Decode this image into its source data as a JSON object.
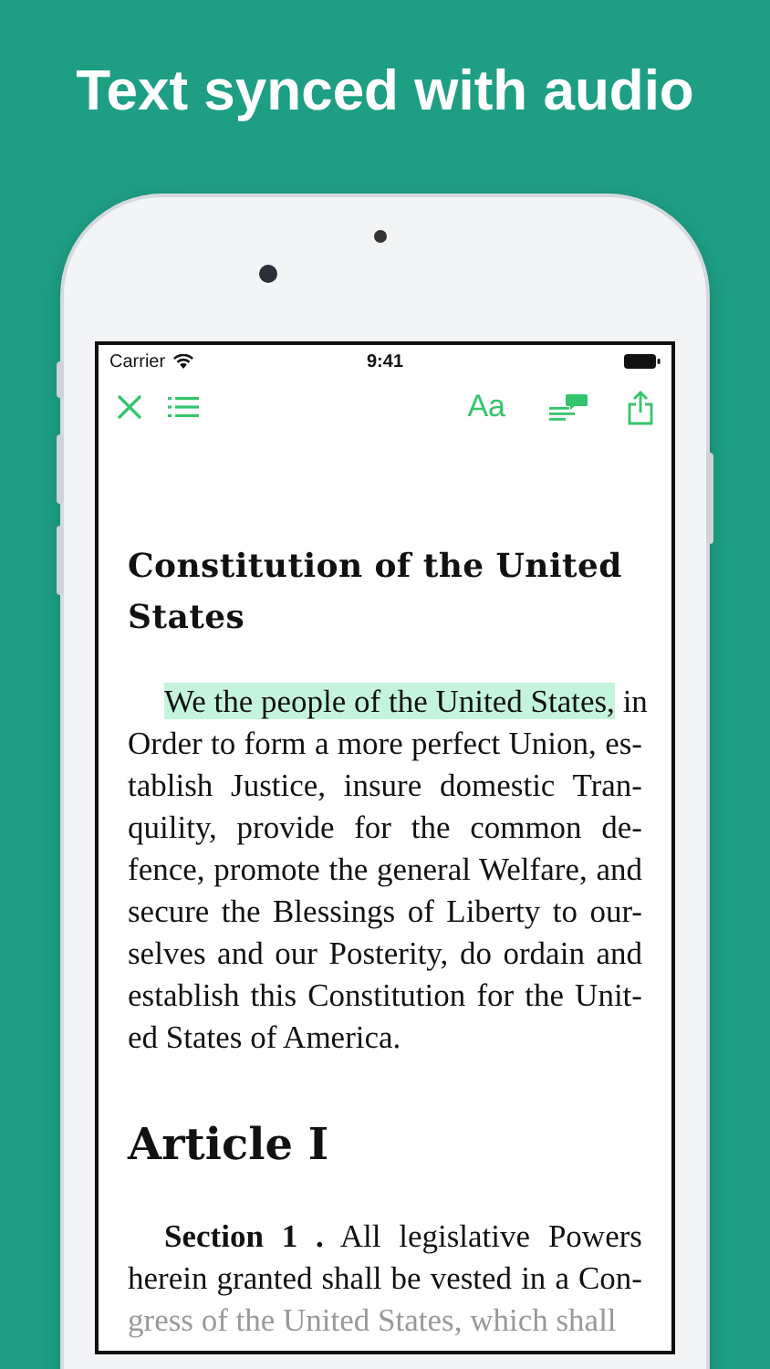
{
  "headline": "Text synced with audio",
  "status_bar": {
    "carrier": "Carrier",
    "time": "9:41"
  },
  "toolbar": {
    "font_button": "Aa"
  },
  "document": [
    {
      "kind": "title",
      "text": "Constitution of the United States"
    },
    {
      "kind": "paragraph",
      "lines": [
        [
          {
            "text": "We the people of the United States,",
            "highlighted": true
          },
          {
            "text": " in",
            "highlighted": false
          }
        ],
        [
          {
            "text": "Order to form a more perfect Union, es-",
            "highlighted": false
          }
        ],
        [
          {
            "text": "tablish Justice, insure domestic Tran-",
            "highlighted": false
          }
        ],
        [
          {
            "text": "quility, provide for the common de-",
            "highlighted": false
          }
        ],
        [
          {
            "text": "fence, promote the general Welfare, and",
            "highlighted": false
          }
        ],
        [
          {
            "text": "secure the Blessings of Liberty to our-",
            "highlighted": false
          }
        ],
        [
          {
            "text": "selves and our Posterity, do ordain and",
            "highlighted": false
          }
        ],
        [
          {
            "text": "establish this Constitution for the Unit-",
            "highlighted": false
          }
        ],
        [
          {
            "text": "ed States of America.",
            "highlighted": false
          }
        ]
      ]
    },
    {
      "kind": "heading",
      "text": "Article I"
    },
    {
      "kind": "paragraph",
      "lines": [
        [
          {
            "text": "**Section 1 .** All legislative Powers",
            "highlighted": false
          }
        ],
        [
          {
            "text": "herein granted shall be vested in a Con-",
            "highlighted": false
          }
        ],
        [
          {
            "text": "gress of the United States, which shall",
            "highlighted": false
          }
        ]
      ]
    }
  ]
}
